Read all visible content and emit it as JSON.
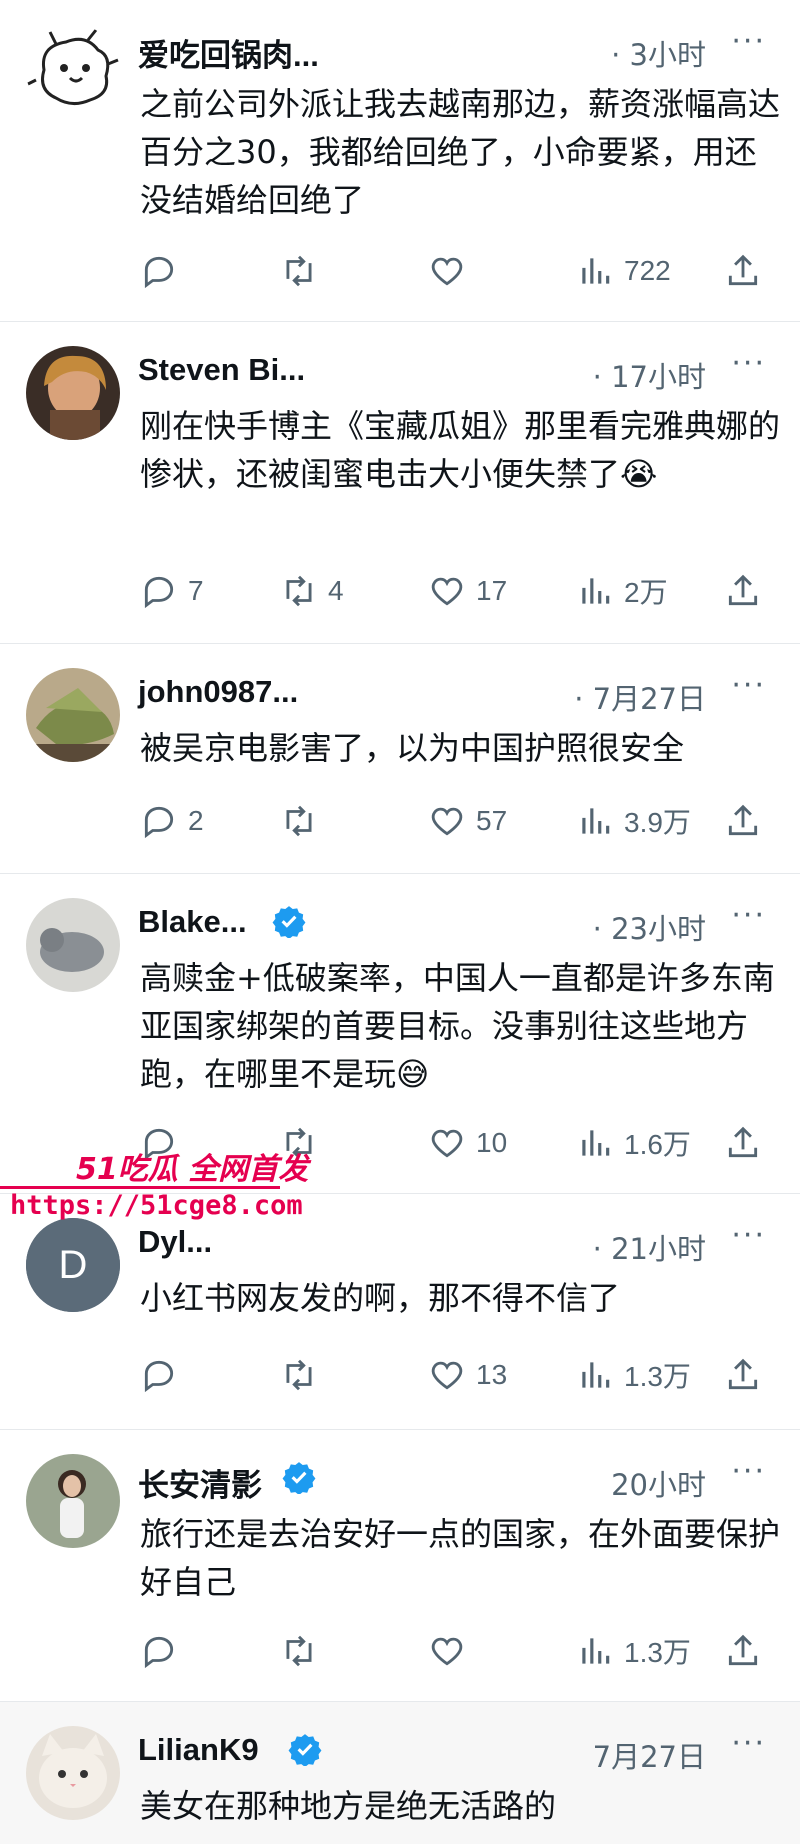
{
  "tweets": [
    {
      "name": "爱吃回锅肉...",
      "time": "· 3小时",
      "more": "···",
      "text": "之前公司外派让我去越南那边，薪资涨幅高达百分之30，我都给回绝了，小命要紧，用还没结婚给回绝了",
      "verified": false,
      "avatar": "cartoon-dog",
      "reply": "",
      "retweet": "",
      "like": "",
      "views": "722"
    },
    {
      "name": "Steven Bi...",
      "time": "· 17小时",
      "more": "···",
      "text": "刚在快手博主《宝藏瓜姐》那里看完雅典娜的惨状，还被闺蜜电击大小便失禁了😭",
      "verified": false,
      "avatar": "photo-woman",
      "reply": "7",
      "retweet": "4",
      "like": "17",
      "views": "2万"
    },
    {
      "name": "john0987...",
      "time": "· 7月27日",
      "more": "···",
      "text": "被吴京电影害了，以为中国护照很安全",
      "verified": false,
      "avatar": "photo-food",
      "reply": "2",
      "retweet": "",
      "like": "57",
      "views": "3.9万"
    },
    {
      "name": "Blake...",
      "time": "· 23小时",
      "more": "···",
      "text": "高赎金+低破案率，中国人一直都是许多东南亚国家绑架的首要目标。没事别往这些地方跑，在哪里不是玩😅",
      "verified": true,
      "avatar": "photo-animal",
      "reply": "",
      "retweet": "",
      "like": "10",
      "views": "1.6万"
    },
    {
      "name": "Dyl...",
      "time": "· 21小时",
      "more": "···",
      "text": "小红书网友发的啊，那不得不信了",
      "verified": false,
      "avatar": "letter-d",
      "avatar_letter": "D",
      "reply": "",
      "retweet": "",
      "like": "13",
      "views": "1.3万"
    },
    {
      "name": "长安清影",
      "time": "20小时",
      "more": "···",
      "text": "旅行还是去治安好一点的国家，在外面要保护好自己",
      "verified": true,
      "avatar": "photo-person",
      "reply": "",
      "retweet": "",
      "like": "",
      "views": "1.3万"
    },
    {
      "name": "LilianK9",
      "time": "7月27日",
      "more": "···",
      "text": "美女在那种地方是绝无活路的",
      "verified": true,
      "avatar": "photo-cat",
      "reply": "",
      "retweet": "",
      "like": "",
      "views": ""
    }
  ],
  "watermark": {
    "title": "51吃瓜 全网首发",
    "url": "https://51cge8.com"
  },
  "colors": {
    "text": "#0f1419",
    "muted": "#536471",
    "verified": "#1d9bf0",
    "watermark": "#e5004f",
    "divider": "#e6e9ec"
  }
}
